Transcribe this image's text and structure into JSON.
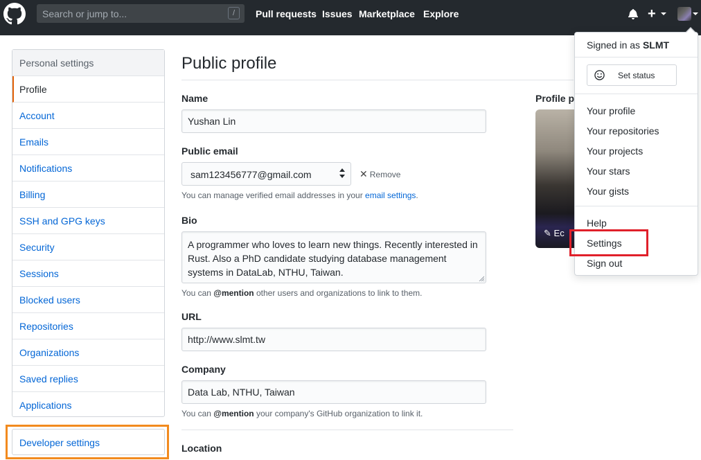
{
  "header": {
    "search_placeholder": "Search or jump to...",
    "search_key": "/",
    "nav": [
      "Pull requests",
      "Issues",
      "Marketplace",
      "Explore"
    ],
    "bg_color": "#24292e"
  },
  "sidebar": {
    "heading": "Personal settings",
    "items": [
      {
        "label": "Profile"
      },
      {
        "label": "Account"
      },
      {
        "label": "Emails"
      },
      {
        "label": "Notifications"
      },
      {
        "label": "Billing"
      },
      {
        "label": "SSH and GPG keys"
      },
      {
        "label": "Security"
      },
      {
        "label": "Sessions"
      },
      {
        "label": "Blocked users"
      },
      {
        "label": "Repositories"
      },
      {
        "label": "Organizations"
      },
      {
        "label": "Saved replies"
      },
      {
        "label": "Applications"
      }
    ],
    "developer_settings": "Developer settings"
  },
  "main": {
    "title": "Public profile",
    "name_label": "Name",
    "name_value": "Yushan Lin",
    "email_label": "Public email",
    "email_value": "sam123456777@gmail.com",
    "remove_label": "Remove",
    "email_note_prefix": "You can manage verified email addresses in your ",
    "email_note_link": "email settings",
    "email_note_suffix": ".",
    "bio_label": "Bio",
    "bio_value": "A programmer who loves to learn new things. Recently interested in Rust. Also a PhD candidate studying database management systems in DataLab, NTHU, Taiwan.",
    "bio_note_prefix": "You can ",
    "bio_note_bold": "@mention",
    "bio_note_suffix": " other users and organizations to link to them.",
    "url_label": "URL",
    "url_value": "http://www.slmt.tw",
    "company_label": "Company",
    "company_value": "Data Lab, NTHU, Taiwan",
    "company_note_prefix": "You can ",
    "company_note_bold": "@mention",
    "company_note_suffix": " your company's GitHub organization to link it.",
    "location_label": "Location",
    "profile_picture_label": "Profile pi",
    "edit_label": "Ec"
  },
  "dropdown": {
    "signed_in_prefix": "Signed in as ",
    "username": "SLMT",
    "set_status": "Set status",
    "items_group1": [
      "Your profile",
      "Your repositories",
      "Your projects",
      "Your stars",
      "Your gists"
    ],
    "items_group2": [
      "Help",
      "Settings",
      "Sign out"
    ]
  },
  "colors": {
    "link": "#0366d6",
    "selected_accent": "#e36209",
    "highlight_orange": "#f28a1e",
    "highlight_red": "#e0202a"
  }
}
